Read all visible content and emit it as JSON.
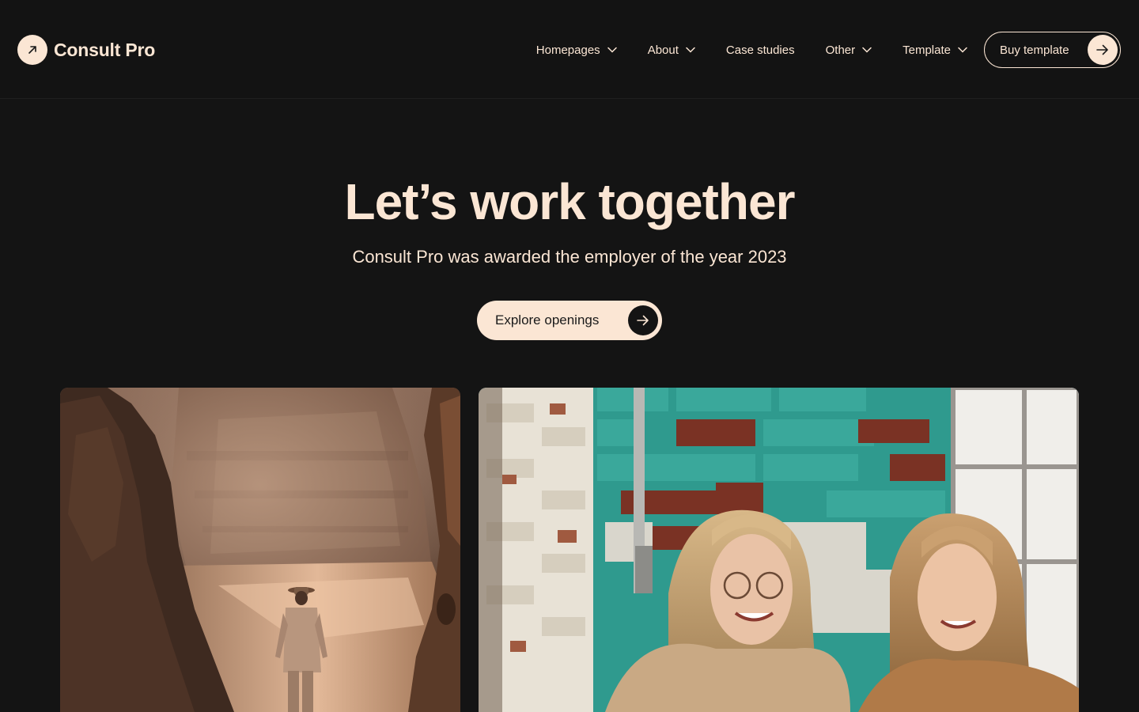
{
  "brand": {
    "name": "Consult Pro",
    "logo_icon": "arrow-up-right-icon"
  },
  "nav": {
    "items": [
      {
        "label": "Homepages",
        "has_dropdown": true
      },
      {
        "label": "About",
        "has_dropdown": true
      },
      {
        "label": "Case studies",
        "has_dropdown": false
      },
      {
        "label": "Other",
        "has_dropdown": true
      },
      {
        "label": "Template",
        "has_dropdown": true
      }
    ],
    "cta_label": "Buy template",
    "cta_icon": "arrow-right-icon"
  },
  "hero": {
    "title": "Let’s work together",
    "subtitle": "Consult Pro was awarded the employer of the year 2023",
    "button_label": "Explore openings",
    "button_icon": "arrow-right-icon"
  },
  "images": {
    "left": "canyon-explorer-photo",
    "right": "two-women-laughing-photo"
  },
  "colors": {
    "background": "#141414",
    "accent": "#fbe6d4",
    "text_dark": "#1a1a1a"
  }
}
